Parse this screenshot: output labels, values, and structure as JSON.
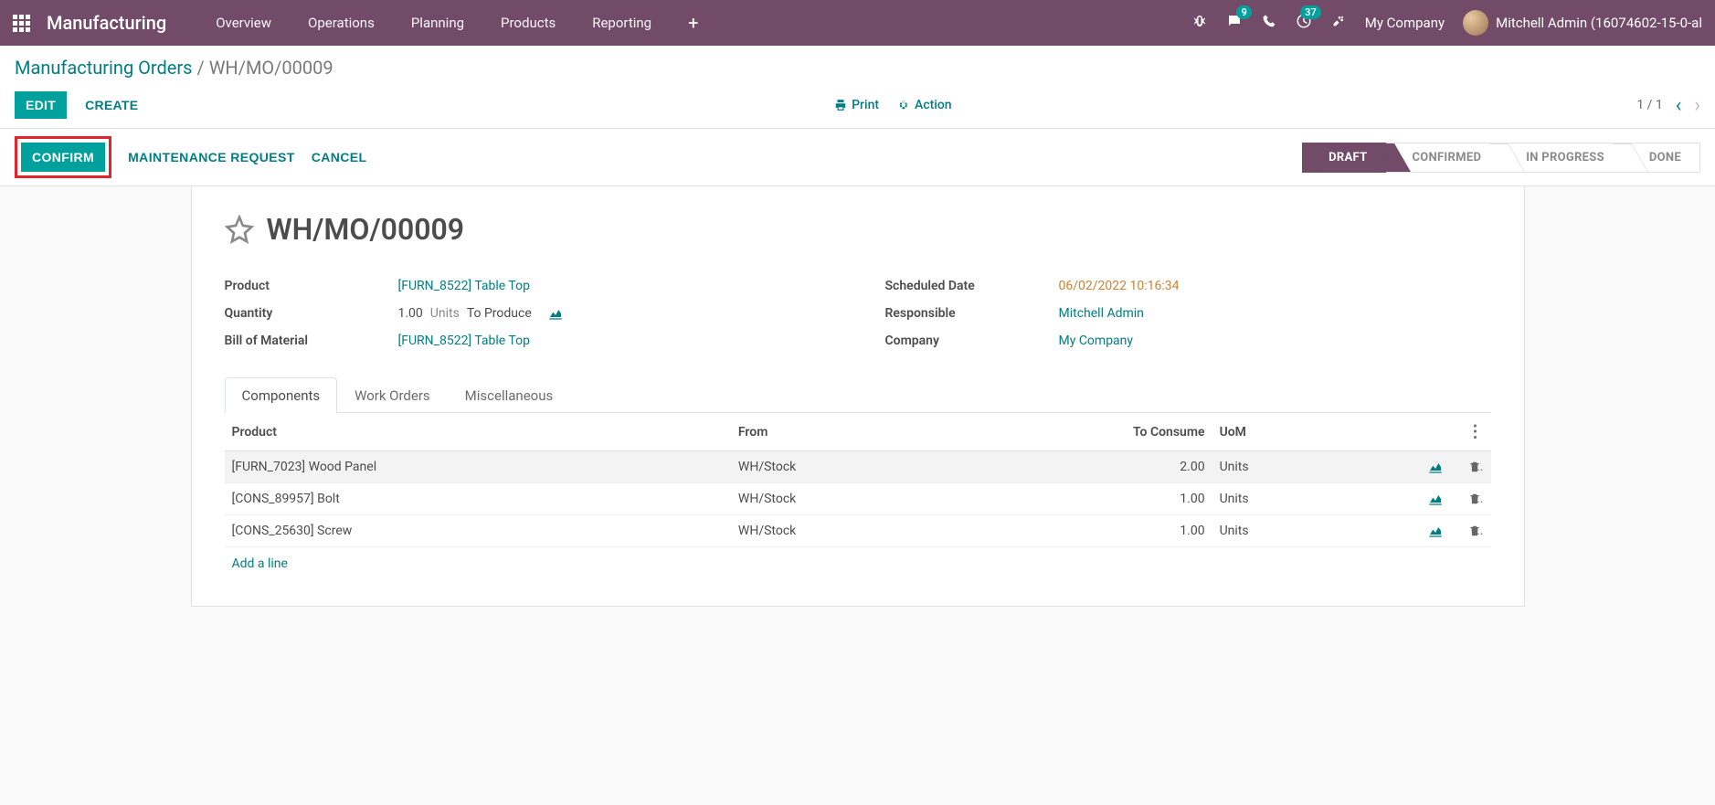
{
  "topnav": {
    "brand": "Manufacturing",
    "menu": [
      "Overview",
      "Operations",
      "Planning",
      "Products",
      "Reporting"
    ],
    "chat_badge": "9",
    "clock_badge": "37",
    "company": "My Company",
    "user": "Mitchell Admin (16074602-15-0-al"
  },
  "breadcrumb": {
    "parent": "Manufacturing Orders",
    "current": "WH/MO/00009"
  },
  "buttons": {
    "edit": "EDIT",
    "create": "CREATE",
    "print": "Print",
    "action": "Action",
    "pager": "1 / 1"
  },
  "status_buttons": {
    "confirm": "CONFIRM",
    "maintenance": "MAINTENANCE REQUEST",
    "cancel": "CANCEL"
  },
  "stages": [
    "DRAFT",
    "CONFIRMED",
    "IN PROGRESS",
    "DONE"
  ],
  "record": {
    "title": "WH/MO/00009",
    "product_label": "Product",
    "product": "[FURN_8522] Table Top",
    "quantity_label": "Quantity",
    "quantity": "1.00",
    "quantity_units": "Units",
    "quantity_suffix": "To Produce",
    "bom_label": "Bill of Material",
    "bom": "[FURN_8522] Table Top",
    "scheduled_label": "Scheduled Date",
    "scheduled": "06/02/2022 10:16:34",
    "responsible_label": "Responsible",
    "responsible": "Mitchell Admin",
    "company_label": "Company",
    "company": "My Company"
  },
  "tabs": [
    "Components",
    "Work Orders",
    "Miscellaneous"
  ],
  "table": {
    "headers": {
      "product": "Product",
      "from": "From",
      "to_consume": "To Consume",
      "uom": "UoM"
    },
    "rows": [
      {
        "product": "[FURN_7023] Wood Panel",
        "from": "WH/Stock",
        "to_consume": "2.00",
        "uom": "Units"
      },
      {
        "product": "[CONS_89957] Bolt",
        "from": "WH/Stock",
        "to_consume": "1.00",
        "uom": "Units"
      },
      {
        "product": "[CONS_25630] Screw",
        "from": "WH/Stock",
        "to_consume": "1.00",
        "uom": "Units"
      }
    ],
    "add_line": "Add a line"
  }
}
